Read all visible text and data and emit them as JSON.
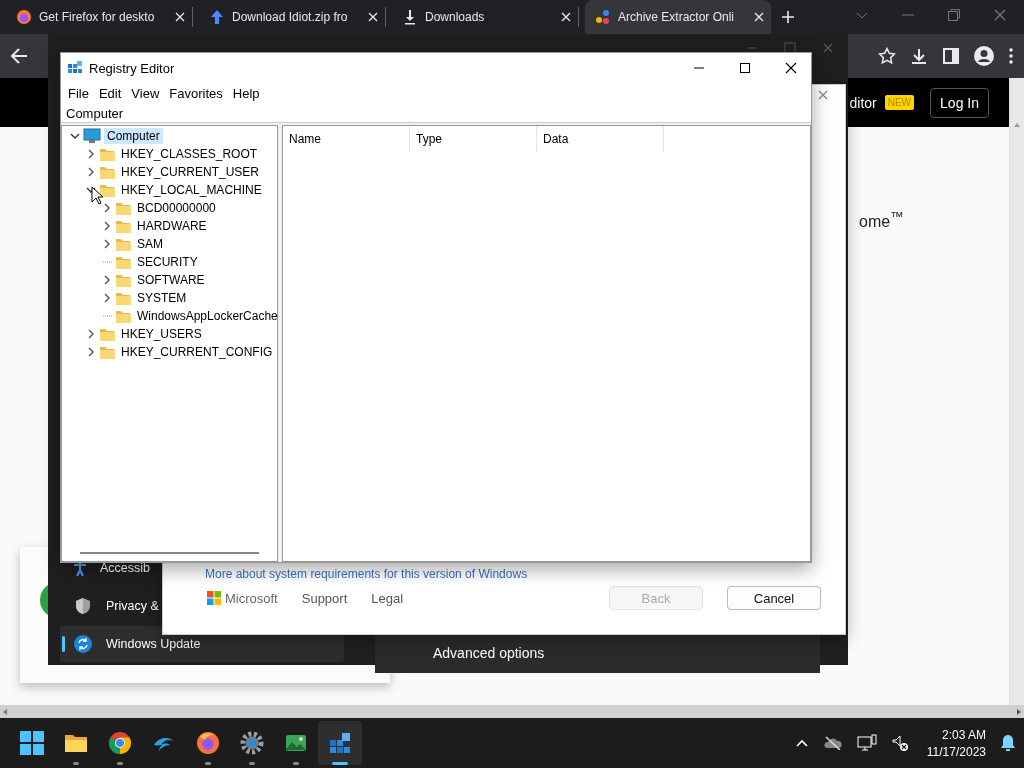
{
  "browser": {
    "tabs": [
      {
        "kind": "firefox",
        "label": "Get Firefox for deskto",
        "selected": false
      },
      {
        "kind": "upload",
        "label": "Download Idiot.zip fro",
        "selected": false
      },
      {
        "kind": "download",
        "label": "Downloads",
        "selected": false
      },
      {
        "kind": "dots",
        "label": "Archive Extractor Onli",
        "selected": true
      }
    ],
    "page": {
      "header_fragment": "ditor",
      "badge": "NEW",
      "login": "Log In",
      "heading_fragment": "ome$^{™}$"
    }
  },
  "settings_window": {
    "nav": [
      {
        "kind": "person",
        "label": "Accessib",
        "selected": false
      },
      {
        "kind": "shield",
        "label": "Privacy &",
        "selected": false
      },
      {
        "kind": "update",
        "label": "Windows Update",
        "selected": true
      }
    ],
    "card": "Advanced options"
  },
  "setup_dialog": {
    "link": "More about system requirements for this version of Windows",
    "brand": "Microsoft",
    "footer_links": [
      "Support",
      "Legal"
    ],
    "buttons": [
      {
        "label": "Back",
        "disabled": true
      },
      {
        "label": "Cancel",
        "disabled": false
      }
    ]
  },
  "registry_editor": {
    "title": "Registry Editor",
    "menu": [
      "File",
      "Edit",
      "View",
      "Favorites",
      "Help"
    ],
    "address": "Computer",
    "tree": [
      {
        "kind": "computer",
        "label": "Computer",
        "selected": true,
        "expandable": true,
        "expanded": true,
        "children": [
          {
            "kind": "folder",
            "label": "HKEY_CLASSES_ROOT",
            "selected": false,
            "expandable": true,
            "expanded": false
          },
          {
            "kind": "folder",
            "label": "HKEY_CURRENT_USER",
            "selected": false,
            "expandable": true,
            "expanded": false
          },
          {
            "kind": "folder",
            "label": "HKEY_LOCAL_MACHINE",
            "selected": false,
            "expandable": true,
            "expanded": true,
            "children": [
              {
                "kind": "folder",
                "label": "BCD00000000",
                "selected": false,
                "expandable": true,
                "expanded": false
              },
              {
                "kind": "folder",
                "label": "HARDWARE",
                "selected": false,
                "expandable": true,
                "expanded": false
              },
              {
                "kind": "folder",
                "label": "SAM",
                "selected": false,
                "expandable": true,
                "expanded": false
              },
              {
                "kind": "folder",
                "label": "SECURITY",
                "selected": false,
                "expandable": false
              },
              {
                "kind": "folder",
                "label": "SOFTWARE",
                "selected": false,
                "expandable": true,
                "expanded": false
              },
              {
                "kind": "folder",
                "label": "SYSTEM",
                "selected": false,
                "expandable": true,
                "expanded": false
              },
              {
                "kind": "folder",
                "label": "WindowsAppLockerCache",
                "selected": false,
                "expandable": false
              }
            ]
          },
          {
            "kind": "folder",
            "label": "HKEY_USERS",
            "selected": false,
            "expandable": true,
            "expanded": false
          },
          {
            "kind": "folder",
            "label": "HKEY_CURRENT_CONFIG",
            "selected": false,
            "expandable": true,
            "expanded": false
          }
        ]
      }
    ],
    "columns": [
      "Name",
      "Type",
      "Data"
    ]
  },
  "taskbar": {
    "apps": [
      {
        "kind": "start",
        "running": false,
        "selected": false
      },
      {
        "kind": "folder",
        "running": true,
        "selected": false
      },
      {
        "kind": "chrome",
        "running": true,
        "selected": false
      },
      {
        "kind": "dolphin",
        "running": false,
        "selected": false
      },
      {
        "kind": "firefox",
        "running": true,
        "selected": false
      },
      {
        "kind": "gear",
        "running": true,
        "selected": false
      },
      {
        "kind": "photo",
        "running": true,
        "selected": false
      },
      {
        "kind": "regedit",
        "running": true,
        "selected": true
      }
    ],
    "clock": {
      "time": "2:03 AM",
      "date": "11/17/2023"
    }
  }
}
